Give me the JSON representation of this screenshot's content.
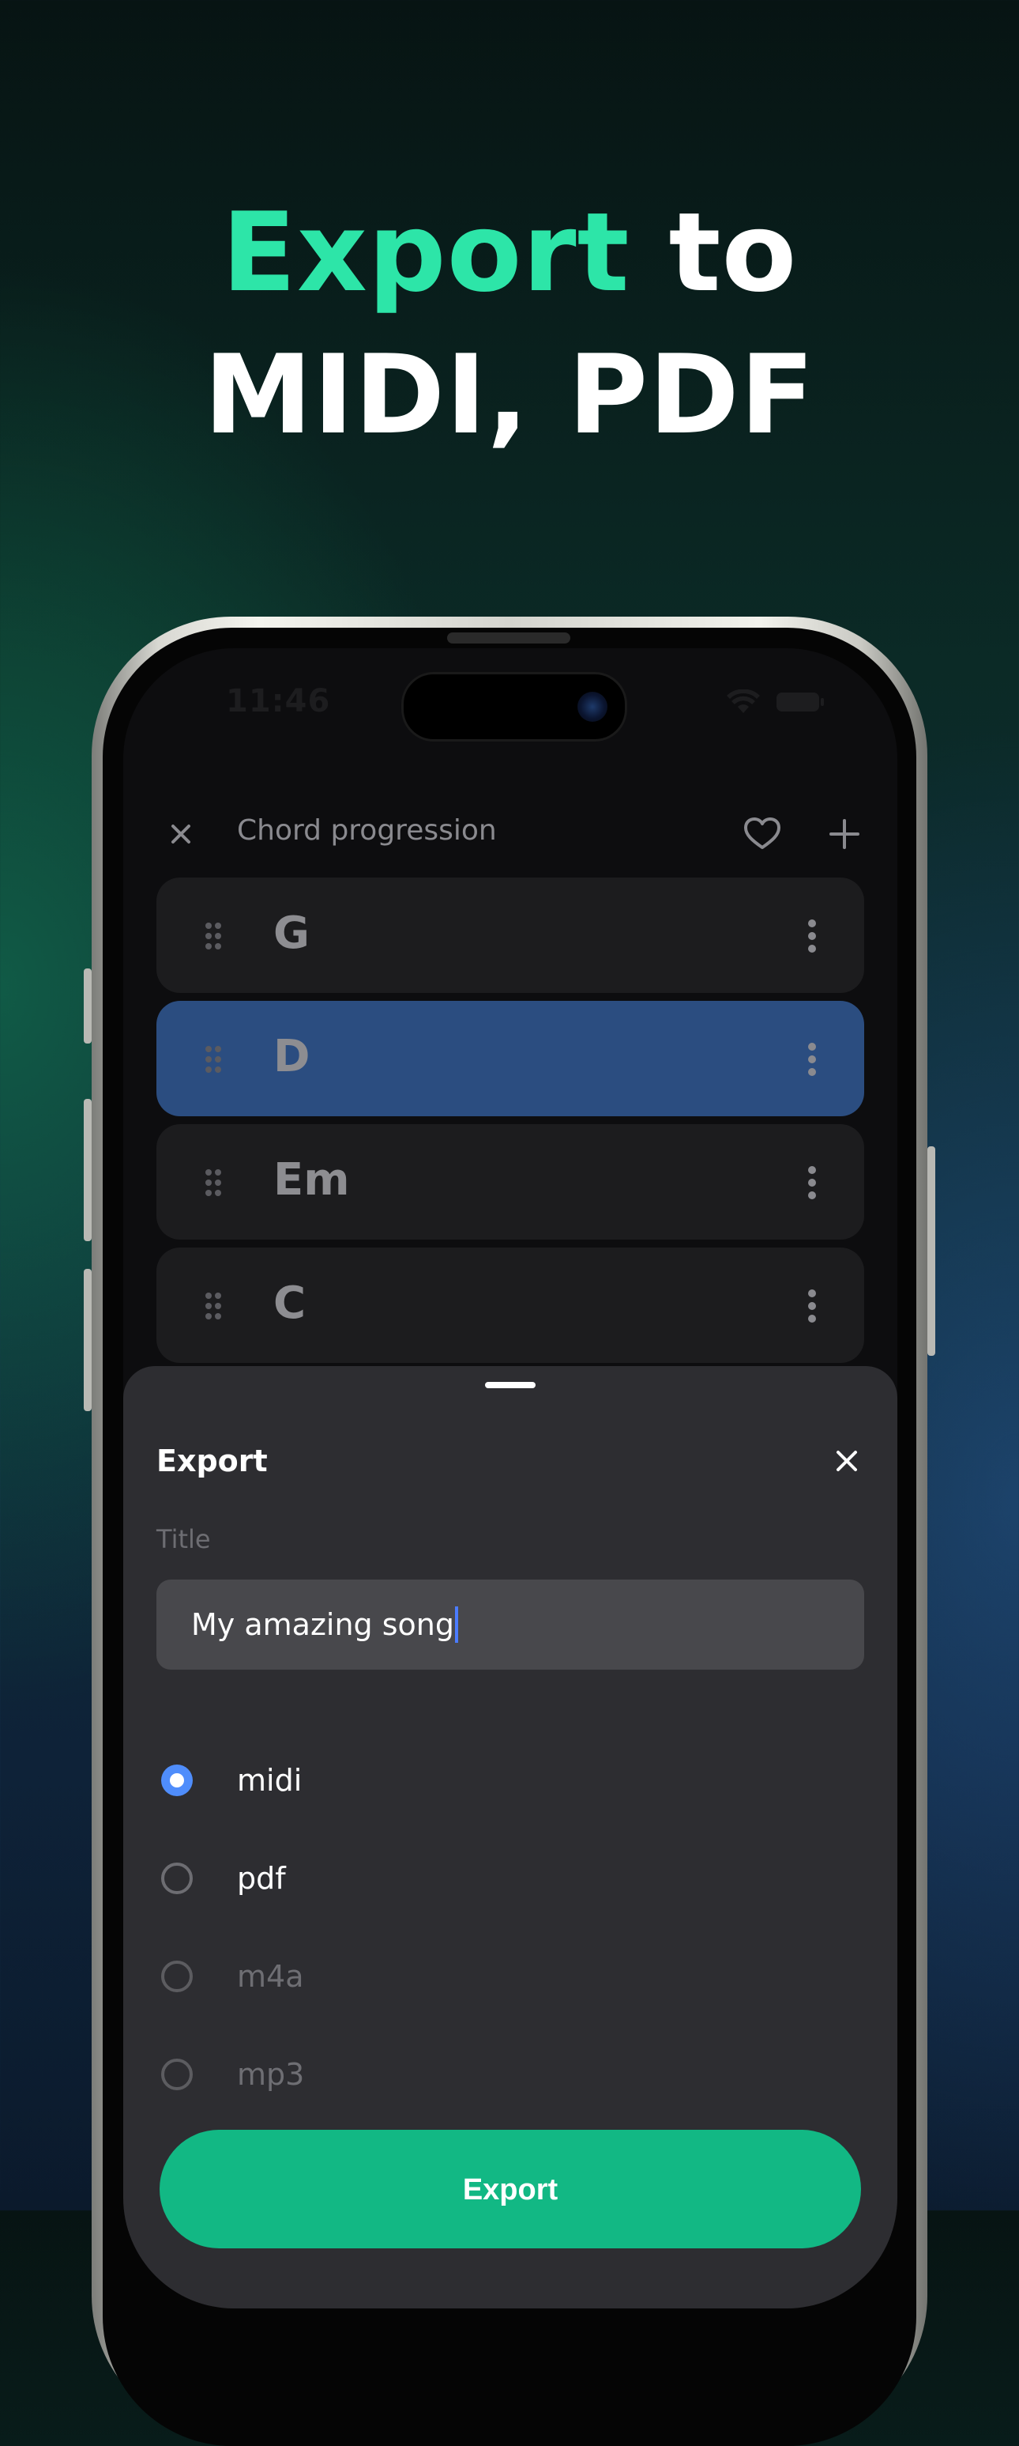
{
  "headline": {
    "accent": "Export",
    "rest_line1": " to",
    "line2": "MIDI, PDF"
  },
  "status_bar": {
    "time": "11:46"
  },
  "app_header": {
    "title": "Chord progression",
    "close_icon": "close-icon",
    "heart_icon": "heart-icon",
    "add_icon": "plus-icon"
  },
  "chords": [
    {
      "name": "G",
      "selected": false
    },
    {
      "name": "D",
      "selected": true
    },
    {
      "name": "Em",
      "selected": false
    },
    {
      "name": "C",
      "selected": false
    }
  ],
  "export_sheet": {
    "title": "Export",
    "field_label": "Title",
    "title_value": "My amazing song",
    "formats": [
      {
        "label": "midi",
        "checked": true,
        "enabled": true
      },
      {
        "label": "pdf",
        "checked": false,
        "enabled": true
      },
      {
        "label": "m4a",
        "checked": false,
        "enabled": false
      },
      {
        "label": "mp3",
        "checked": false,
        "enabled": false
      }
    ],
    "export_button": "Export"
  },
  "colors": {
    "accent_green": "#2de5a8",
    "button_green": "#12b884",
    "selected_row": "#2b4d80",
    "radio_blue": "#4f8dfb"
  }
}
